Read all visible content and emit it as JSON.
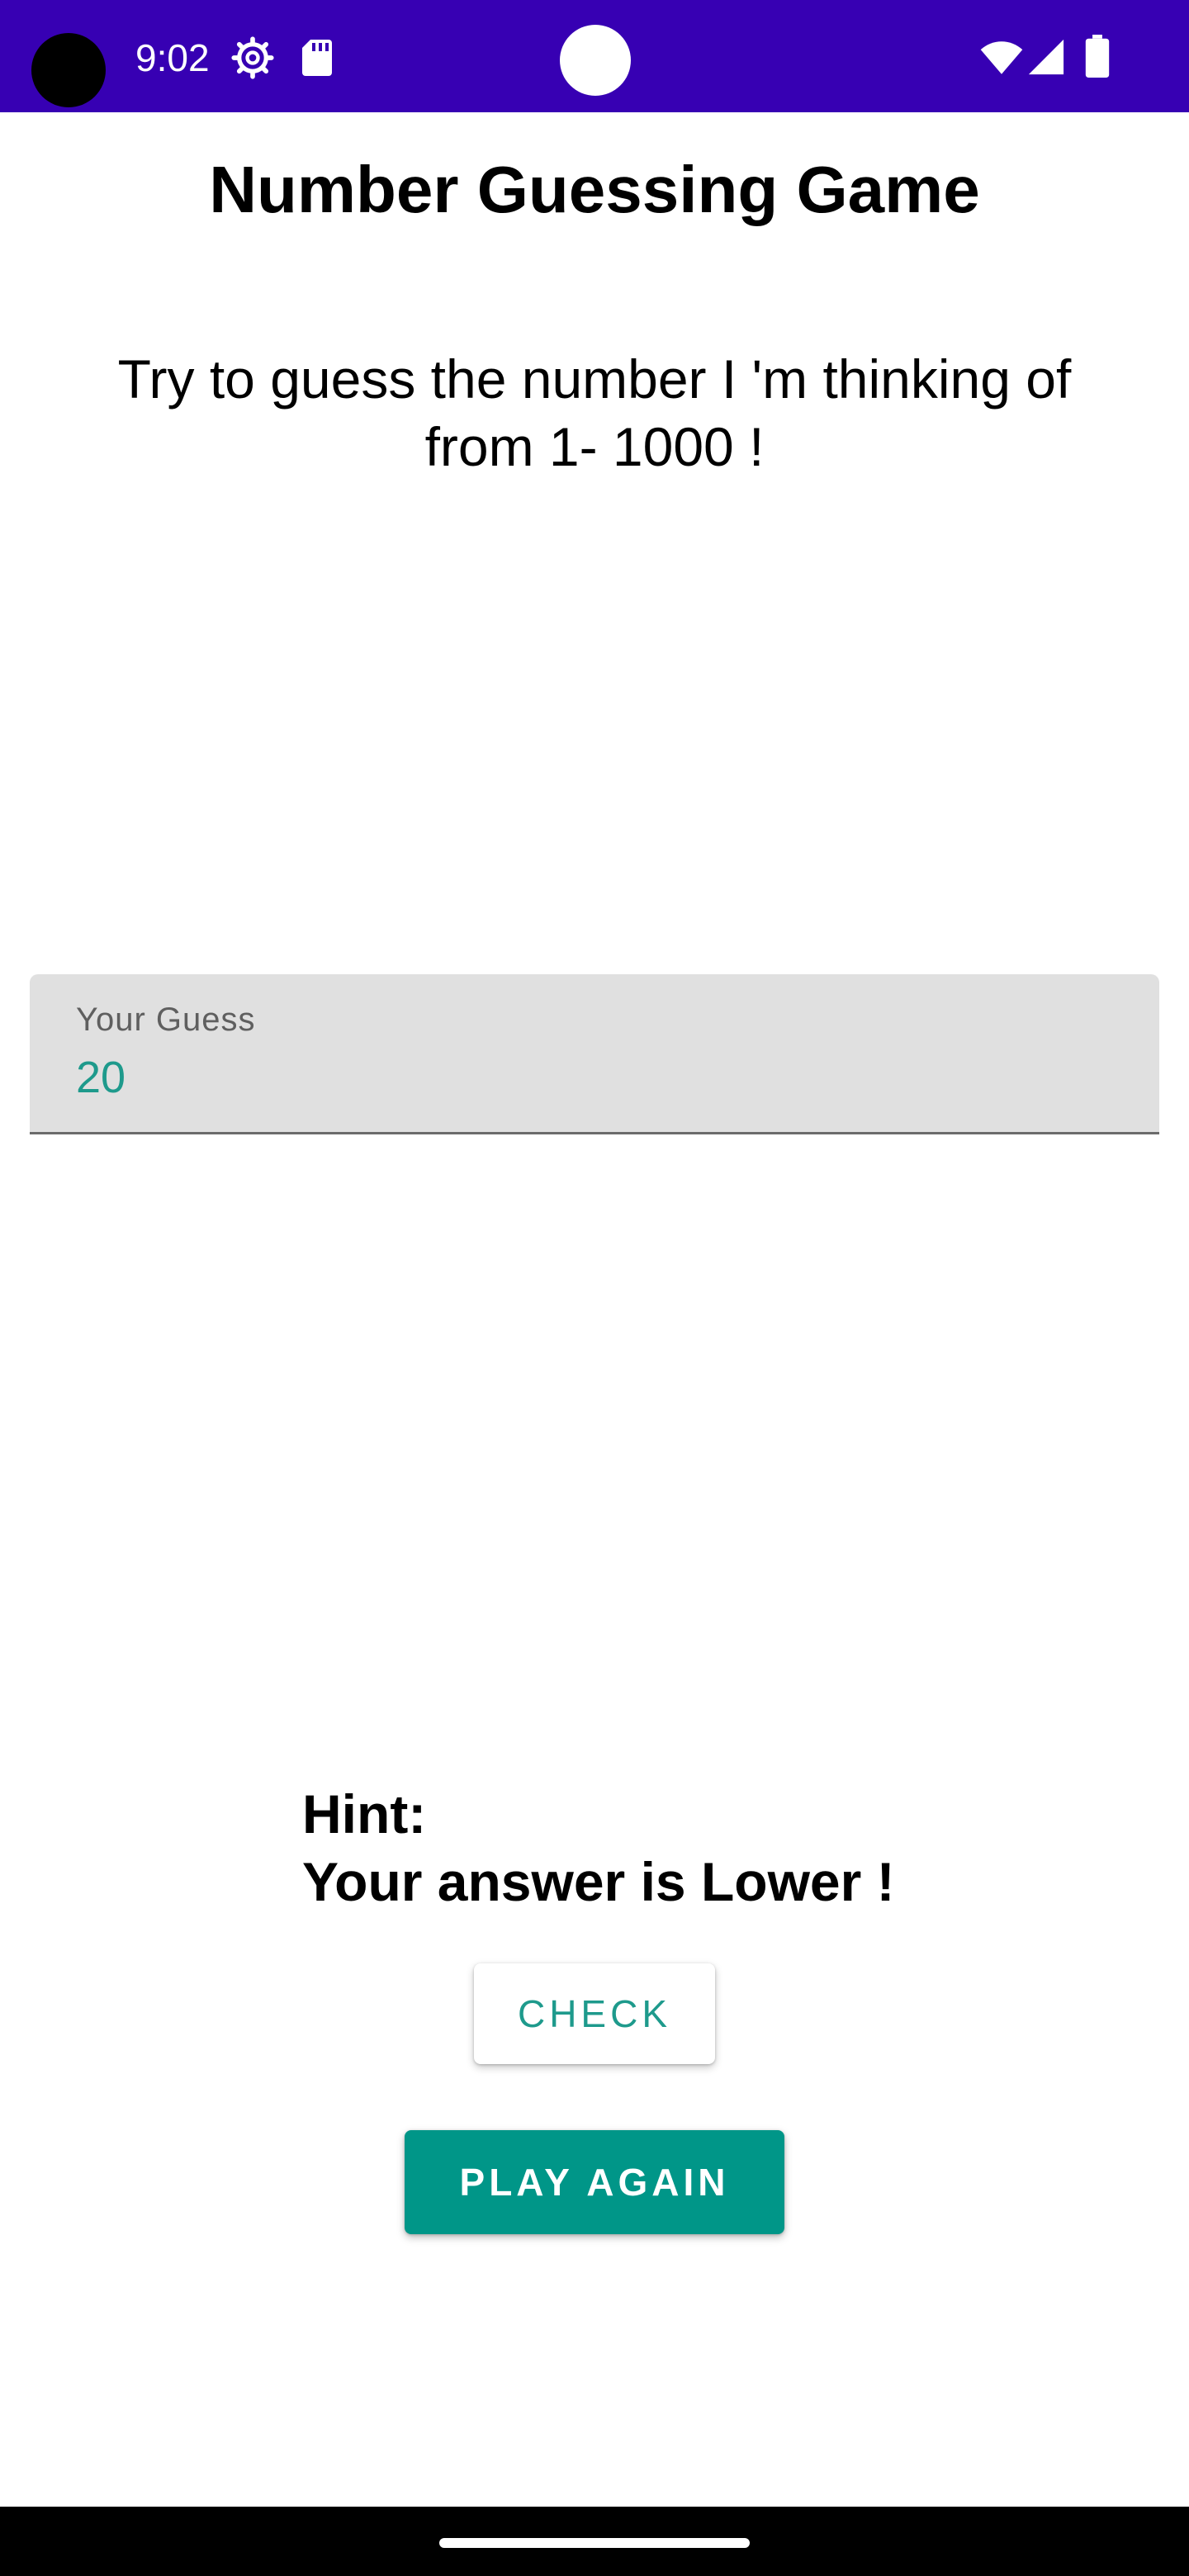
{
  "status_bar": {
    "time": "9:02",
    "icons": [
      "camera-cutout",
      "gear-icon",
      "sd-card-icon",
      "wifi-icon",
      "signal-icon",
      "battery-icon"
    ],
    "background_color": "#3700b3"
  },
  "title": "Number Guessing Game",
  "instructions": "Try to guess the number I 'm thinking of from 1- 1000 !",
  "guess_field": {
    "label": "Your Guess",
    "value": "20"
  },
  "hint": {
    "label": "Hint:",
    "message": "Your answer is Lower !"
  },
  "buttons": {
    "check_label": "CHECK",
    "play_again_label": "PLAY AGAIN"
  },
  "colors": {
    "accent": "#009688",
    "accent_text": "#1e9a8c",
    "field_background": "#e0e0e0"
  }
}
